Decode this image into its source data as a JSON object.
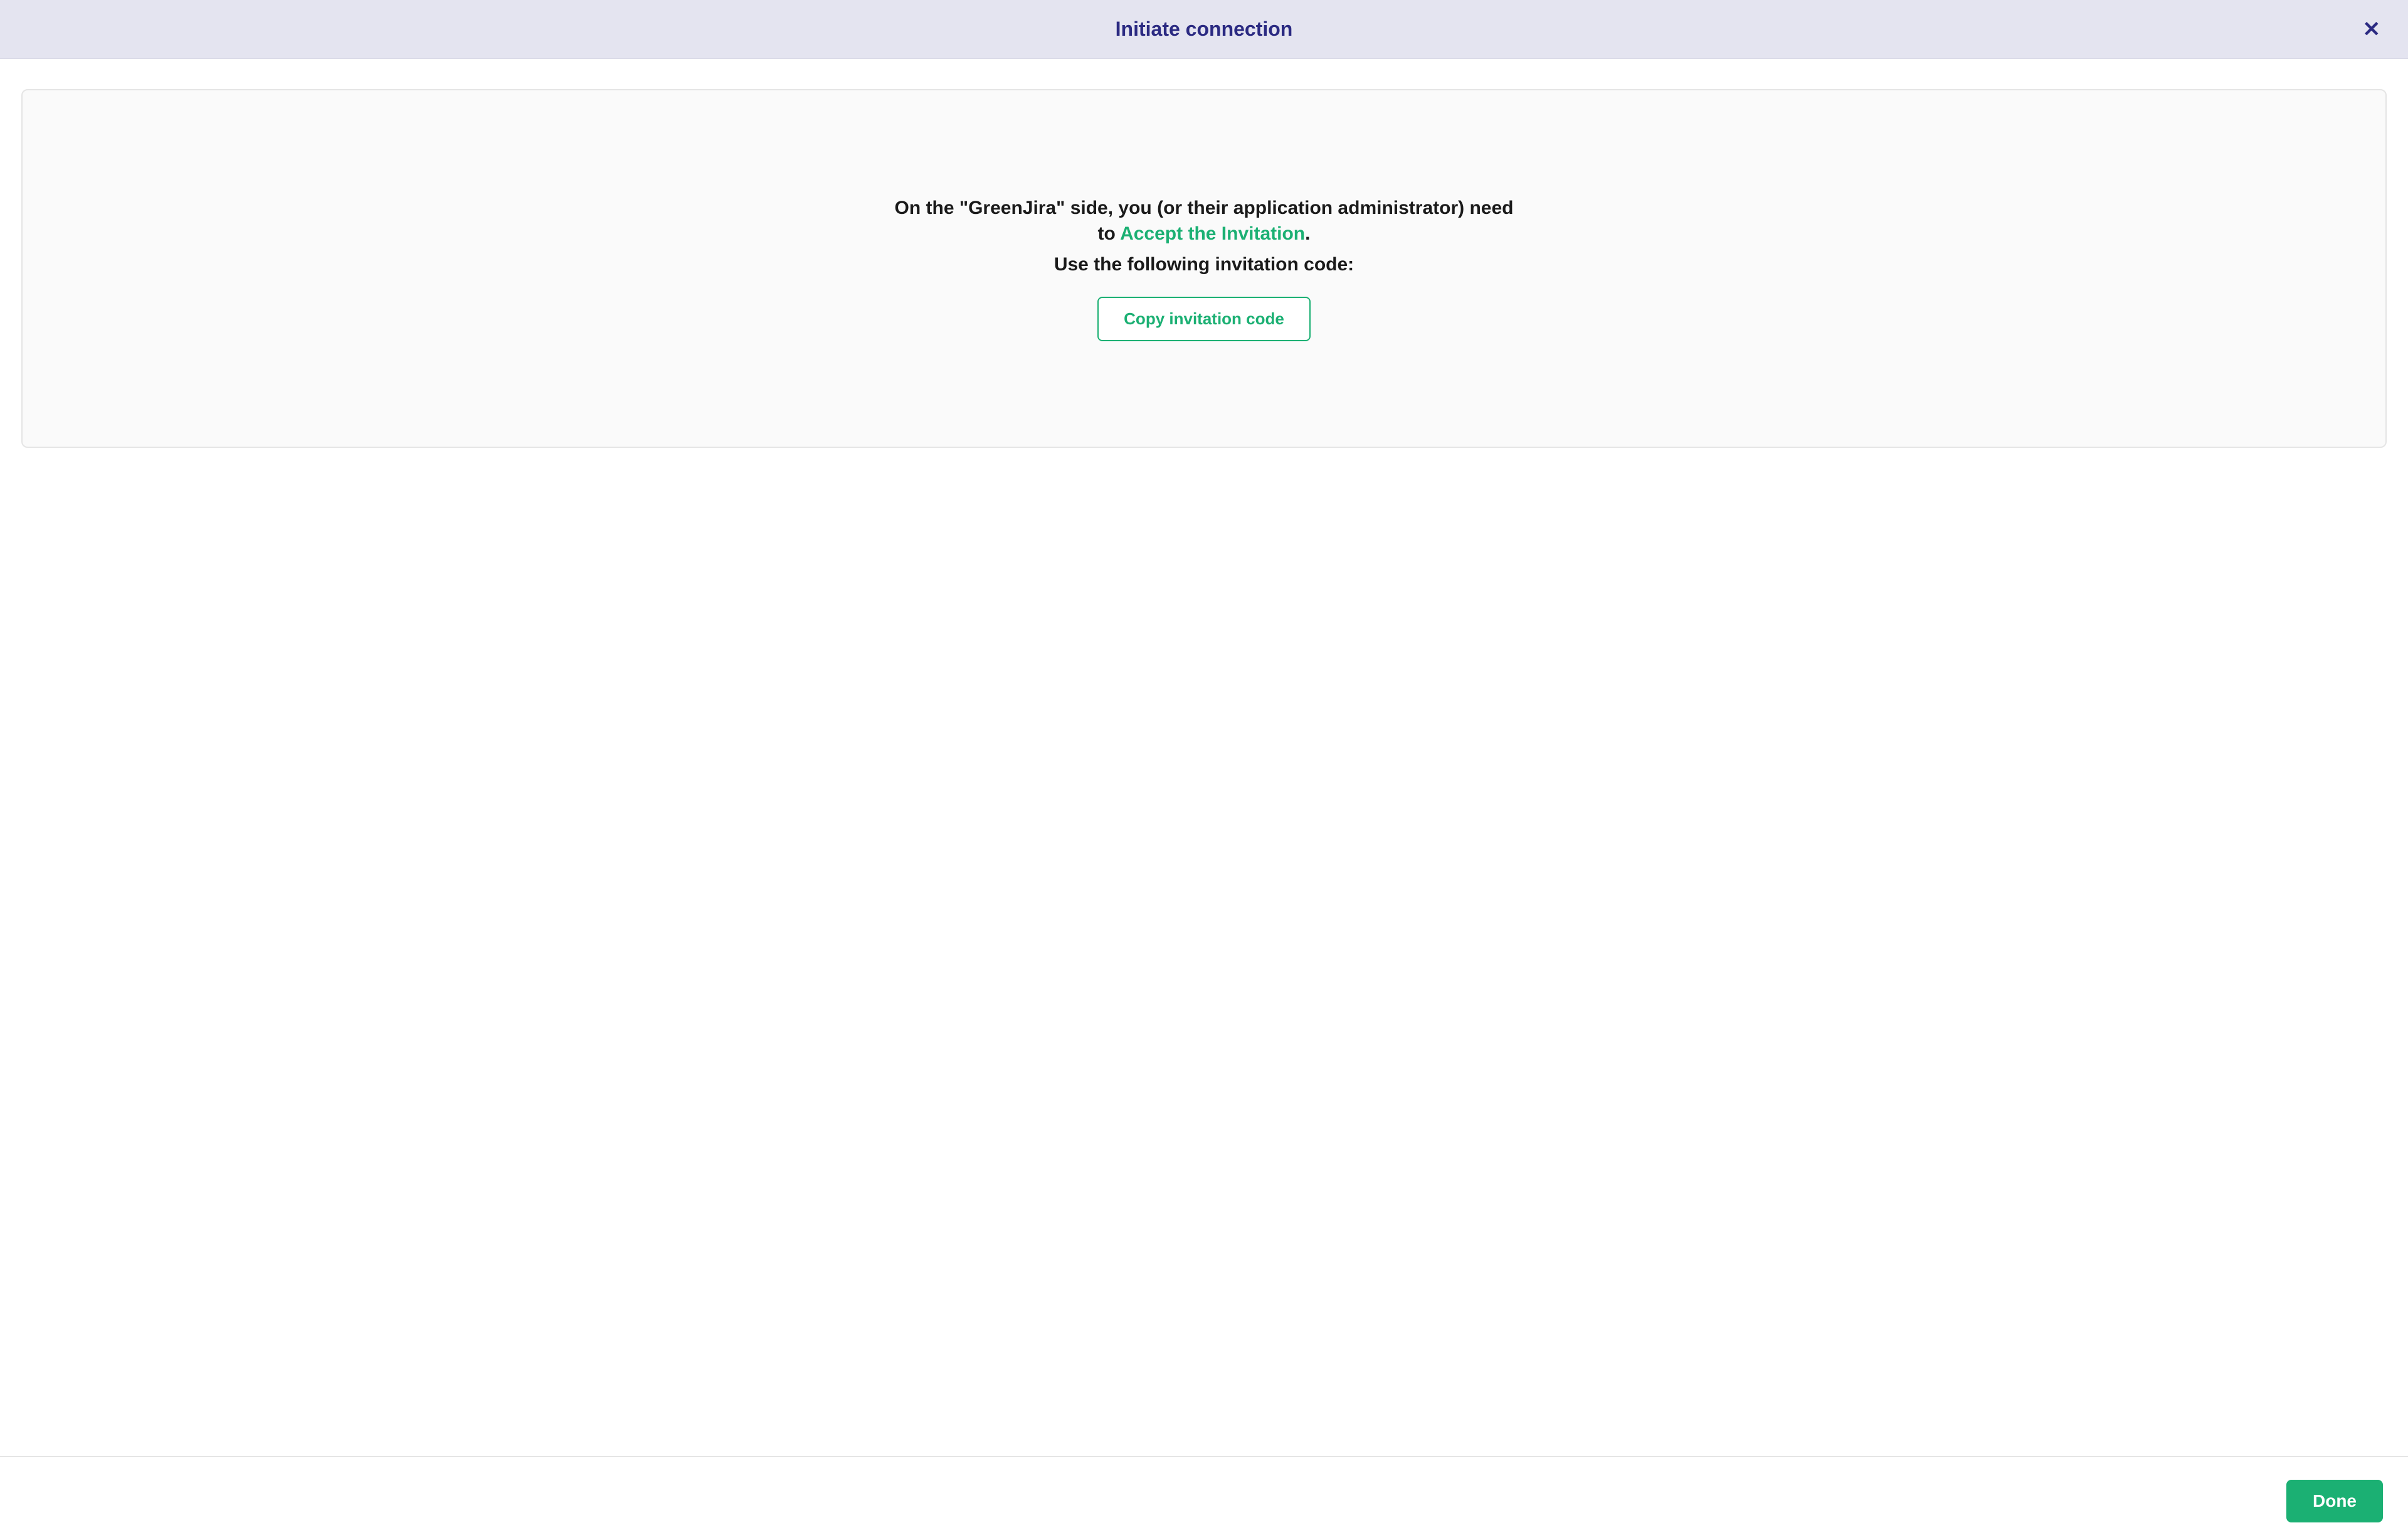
{
  "modal": {
    "title": "Initiate connection",
    "close_label": "✕"
  },
  "content": {
    "instruction_prefix": "On the \"GreenJira\" side, you (or their application administrator) need to ",
    "instruction_link": "Accept the Invitation",
    "instruction_suffix": ".",
    "code_label": "Use the following invitation code:",
    "copy_button_label": "Copy invitation code"
  },
  "footer": {
    "done_label": "Done"
  }
}
